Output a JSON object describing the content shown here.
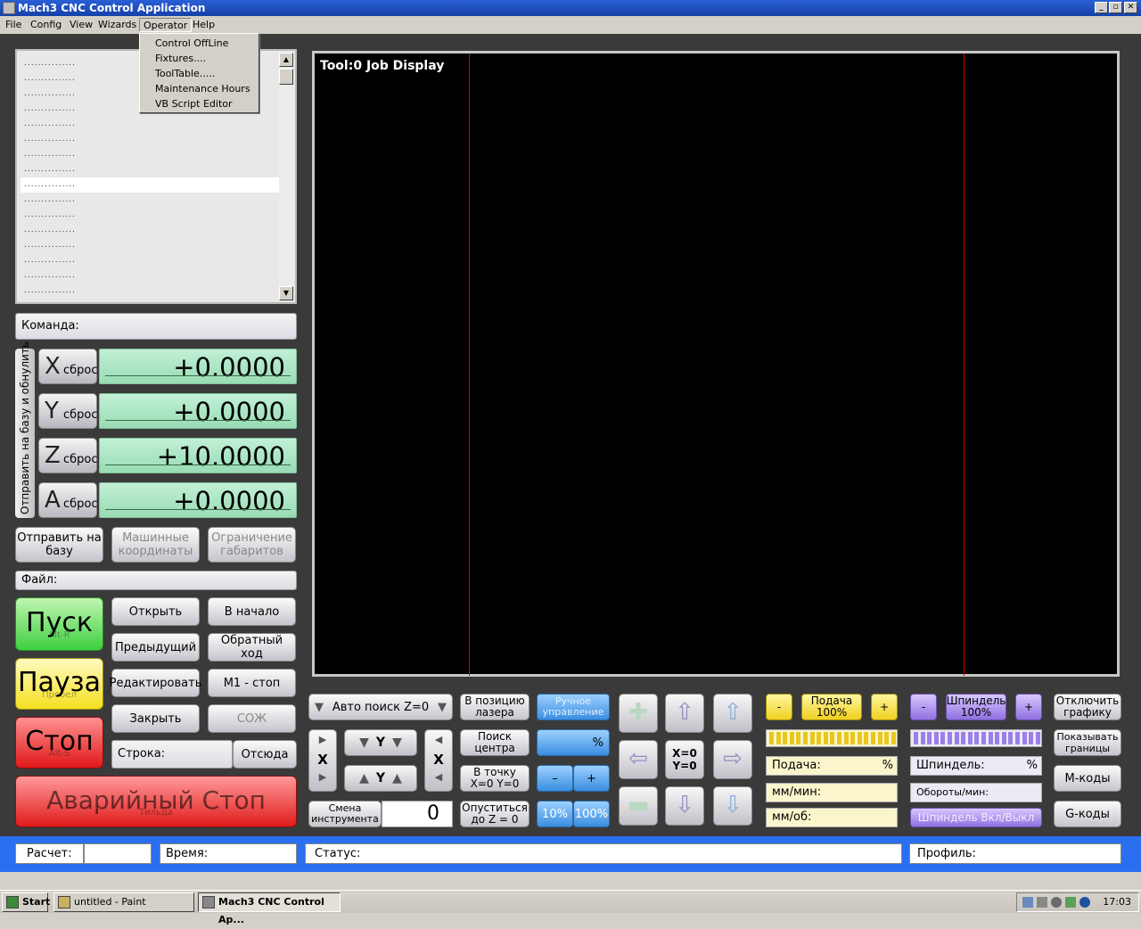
{
  "window": {
    "title": "Mach3 CNC Control Application",
    "btn_min": "_",
    "btn_max": "▫",
    "btn_close": "✕"
  },
  "menu": {
    "items": [
      "File",
      "Config",
      "View",
      "Wizards",
      "Operator",
      "Help"
    ],
    "active": "Operator"
  },
  "operator_menu": [
    "Control OffLine",
    "Fixtures....",
    "ToolTable.....",
    "Maintenance Hours",
    "VB Script Editor"
  ],
  "gcode": {
    "lines": [
      "...............",
      "...............",
      "...............",
      "...............",
      "...............",
      "...............",
      "...............",
      "...............",
      "...............",
      "...............",
      "...............",
      "...............",
      "...............",
      "...............",
      "...............",
      "..............."
    ],
    "selected_index": 8
  },
  "command": {
    "label": "Команда:"
  },
  "dro": {
    "side_label": "Отправить на базу и обнулить",
    "reset_label": "сброс",
    "axes": [
      {
        "axis": "X",
        "value": "+0.0000"
      },
      {
        "axis": "Y",
        "value": "+0.0000"
      },
      {
        "axis": "Z",
        "value": "+10.0000"
      },
      {
        "axis": "A",
        "value": "+0.0000"
      }
    ]
  },
  "coord_buttons": {
    "home": "Отправить на базу",
    "machine": "Машинные координаты",
    "limits": "Ограничение габаритов"
  },
  "file": {
    "label": "Файл:"
  },
  "run": {
    "start": "Пуск",
    "start_key": "Alt-R",
    "pause": "Пауза",
    "pause_key": "Пробел",
    "stop": "Стоп",
    "stop_key": "Alt-S",
    "estop": "Аварийный Стоп",
    "estop_key": "Тильда"
  },
  "file_buttons": {
    "open": "Открыть",
    "rewind": "В начало",
    "prev": "Предыдущий",
    "reverse": "Обратный ход",
    "edit": "Редактировать",
    "m1": "M1 - стоп",
    "close": "Закрыть",
    "coolant": "СОЖ"
  },
  "line": {
    "label": "Строка:",
    "from_here": "Отсюда"
  },
  "job": {
    "title": "Tool:0   Job Display"
  },
  "bottom": {
    "auto_z": "Авто поиск Z=0",
    "tool_change": "Смена инструмента",
    "tool_num": "0",
    "laser": "В позицию лазера",
    "center": "Поиск центра",
    "goto_zero": "В точку X=0 Y=0",
    "goto_z": "Опуститься до Z = 0",
    "manual": "Ручное управление",
    "percent": "%",
    "minus": "–",
    "plus": "+",
    "p10": "10%",
    "p100": "100%",
    "x_label": "X",
    "y_label": "Y",
    "xy_zero": "X=0 Y=0",
    "jog_z": "Z",
    "jog_a": "A",
    "feed_minus": "-",
    "feed_plus": "+",
    "feed_pct": "Подача 100%",
    "feed_label": "Подача:",
    "feed_unit": "%",
    "mm_min": "мм/мин:",
    "mm_rev": "мм/об:",
    "spindle_minus": "-",
    "spindle_plus": "+",
    "spindle_pct": "Шпиндель 100%",
    "spindle_label": "Шпиндель:",
    "spindle_unit": "%",
    "rpm_label": "Обороты/мин:",
    "spindle_toggle": "Шпиндель Вкл/Выкл",
    "disable_graphics": "Отключить графику",
    "show_limits": "Показывать границы",
    "mcodes": "M-коды",
    "gcodes": "G-коды"
  },
  "status": {
    "calc": "Расчет:",
    "time": "Время:",
    "status": "Статус:",
    "profile": "Профиль:"
  },
  "taskbar": {
    "start": "Start",
    "task1": "untitled - Paint",
    "task2": "Mach3 CNC Control Ap...",
    "clock": "17:03"
  }
}
